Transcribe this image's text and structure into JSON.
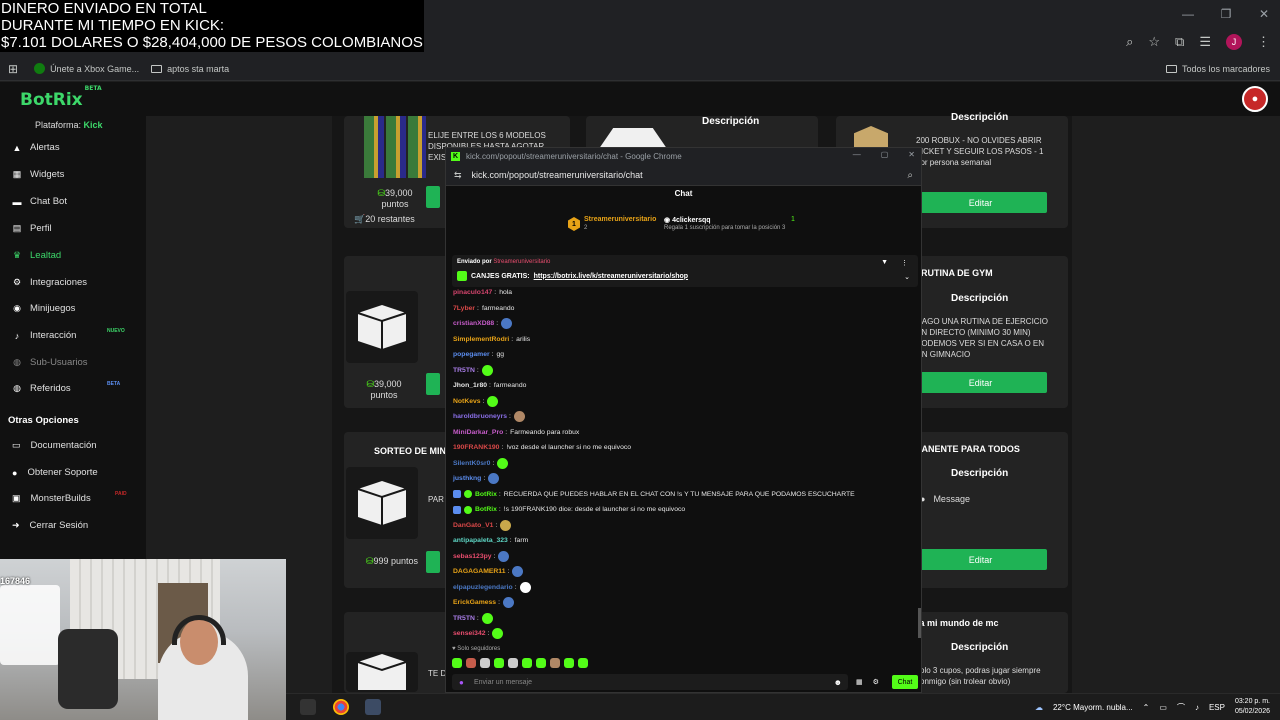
{
  "overlay": {
    "line1": "DINERO ENVIADO EN TOTAL",
    "line2": "DURANTE MI TIEMPO EN KICK:",
    "line3": "$7.101 DOLARES O $28,404,000 DE PESOS COLOMBIANOS"
  },
  "bookmarks": {
    "xbox": "Únete a Xbox Game...",
    "folder1": "aptos sta marta",
    "all": "Todos los marcadores"
  },
  "app": {
    "logo": "BotRix",
    "logo_tag": "BETA"
  },
  "sidebar": {
    "platform_label": "Plataforma:",
    "platform_value": "Kick",
    "items": [
      {
        "label": "Alertas",
        "icon": "bell-icon"
      },
      {
        "label": "Widgets",
        "icon": "grid-icon"
      },
      {
        "label": "Chat Bot",
        "icon": "chat-icon"
      },
      {
        "label": "Perfil",
        "icon": "document-icon"
      },
      {
        "label": "Lealtad",
        "icon": "trophy-icon"
      },
      {
        "label": "Integraciones",
        "icon": "plug-icon"
      },
      {
        "label": "Minijuegos",
        "icon": "gamepad-icon"
      },
      {
        "label": "Interacción",
        "icon": "music-icon",
        "badge": "NUEVO"
      },
      {
        "label": "Sub-Usuarios",
        "icon": "users-icon"
      },
      {
        "label": "Referidos",
        "icon": "referral-icon",
        "badge": "BETA"
      }
    ],
    "section": "Otras Opciones",
    "other": [
      {
        "label": "Documentación",
        "icon": "book-icon"
      },
      {
        "label": "Obtener Soporte",
        "icon": "help-icon"
      },
      {
        "label": "MonsterBuilds",
        "icon": "monitor-icon",
        "badge": "PAID"
      },
      {
        "label": "Cerrar Sesión",
        "icon": "logout-icon"
      }
    ]
  },
  "cards": {
    "c1": {
      "desc_title": "Descripción",
      "desc": "ELIJE ENTRE LOS 6 MODELOS DISPONIBLES HASTA AGOTAR EXIS",
      "points": "39,000",
      "points_unit": "puntos",
      "remaining": "20 restantes"
    },
    "c2": {
      "desc_title": "Descripción"
    },
    "c3": {
      "desc_title": "Descripción",
      "desc": "200 ROBUX - NO OLVIDES ABRIR TICKET Y SEGUIR LOS PASOS - 1 por persona semanal",
      "edit": "Editar"
    },
    "c4": {
      "points": "39,000",
      "points_unit": "puntos"
    },
    "c5": {
      "title": "RUTINA DE GYM",
      "desc_title": "Descripción",
      "desc": "HAGO UNA RUTINA DE EJERCICIO EN DIRECTO (MINIMO 30 MIN) PODEMOS VER SI EN CASA O EN UN GIMNACIO",
      "edit": "Editar"
    },
    "c6": {
      "title": "SORTEO DE MINE",
      "desc": "PAR",
      "points": "999 puntos"
    },
    "c7": {
      "title": "MANENTE PARA TODOS",
      "desc_title": "Descripción",
      "message": "Message",
      "edit": "Editar"
    },
    "c8": {
      "desc": "TE D"
    },
    "c9": {
      "title": "a a mi mundo de mc",
      "desc_title": "Descripción",
      "desc": "solo 3 cupos, podras jugar siempre conmigo (sin trolear obvio)"
    }
  },
  "popup": {
    "title": "kick.com/popout/streameruniversitario/chat - Google Chrome",
    "url": "kick.com/popout/streameruniversitario/chat",
    "chat_header": "Chat",
    "leader1": "Streameruniversitario",
    "leader1_sub": "2",
    "leader2": "4clickersqq",
    "leader2_sub": "Regala 1 suscripción para tomar la posición 3",
    "leader_count": "1",
    "pinned_by": "Enviado por",
    "pinned_user": "Streameruniversitario",
    "pinned_text": "CANJES GRATIS:",
    "pinned_link": "https://botrix.live/k/streameruniversitario/shop",
    "followers": "Solo seguidores",
    "input_placeholder": "Enviar un mensaje",
    "send": "Chat"
  },
  "chat": [
    {
      "user": "pinaculo147",
      "text": "hola",
      "color": "#d6456e"
    },
    {
      "user": "7Lyber",
      "text": "farmeando",
      "color": "#d94848"
    },
    {
      "user": "cristianXD88",
      "text": "",
      "color": "#c65cc9",
      "emote": "#4b78c4"
    },
    {
      "user": "SimplementRodri",
      "text": "arilis",
      "color": "#e8a317"
    },
    {
      "user": "popegamer",
      "text": "gg",
      "color": "#5b8def"
    },
    {
      "user": "TR5TN",
      "text": "",
      "color": "#a97de8",
      "emote": "#53fc18"
    },
    {
      "user": "Jhon_1r80",
      "text": "farmeando",
      "color": "#e8e8e8"
    },
    {
      "user": "NotKevs",
      "text": "",
      "color": "#e8a317",
      "emote": "#53fc18"
    },
    {
      "user": "haroldbruoneyrs",
      "text": "",
      "color": "#8a6fe8",
      "emote": "#b08866"
    },
    {
      "user": "MiniDarkar_Pro",
      "text": "Farmeando para robux",
      "color": "#c65cc9"
    },
    {
      "user": "190FRANK190",
      "text": "!voz desde el launcher si no me equivoco",
      "color": "#d94848"
    },
    {
      "user": "SilentK0sr0",
      "text": "",
      "color": "#4b78c4",
      "emote": "#53fc18"
    },
    {
      "user": "justhkng",
      "text": "",
      "color": "#5b8def",
      "emote": "#4b78c4"
    },
    {
      "user": "BotRix",
      "text": "RECUERDA QUE PUEDES HABLAR EN EL CHAT CON !s Y TU MENSAJE PARA QUE PODAMOS ESCUCHARTE",
      "color": "#53fc18"
    },
    {
      "user": "BotRix",
      "text": "!s 190FRANK190 dice: desde el launcher si no me equivoco",
      "color": "#53fc18"
    },
    {
      "user": "DanGato_V1",
      "text": "",
      "color": "#d94848",
      "emote": "#c8a84b"
    },
    {
      "user": "antipapaleta_323",
      "text": "farm",
      "color": "#5ed6c5"
    },
    {
      "user": "sebas123py",
      "text": "",
      "color": "#e84d6e",
      "emote": "#4b78c4"
    },
    {
      "user": "DAGAGAMER11",
      "text": "",
      "color": "#e8a317",
      "emote": "#4b78c4"
    },
    {
      "user": "elpapuzlegendario",
      "text": "",
      "color": "#4b78c4",
      "emote": "#ffffff"
    },
    {
      "user": "ErickGamess",
      "text": "",
      "color": "#e8a317",
      "emote": "#4b78c4"
    },
    {
      "user": "TR5TN",
      "text": "",
      "color": "#a97de8",
      "emote": "#53fc18"
    },
    {
      "user": "sensei342",
      "text": "",
      "color": "#e84d6e",
      "emote": "#53fc18"
    }
  ],
  "webcam": {
    "overlay_text": "167846"
  },
  "taskbar": {
    "weather": "22°C  Mayorm. nubla...",
    "lang": "ESP",
    "time": "03:20 p. m.",
    "date": "05/02/2026"
  },
  "colors": {
    "brand": "#3dd86a",
    "kick": "#53fc18",
    "edit": "#1fb355"
  }
}
